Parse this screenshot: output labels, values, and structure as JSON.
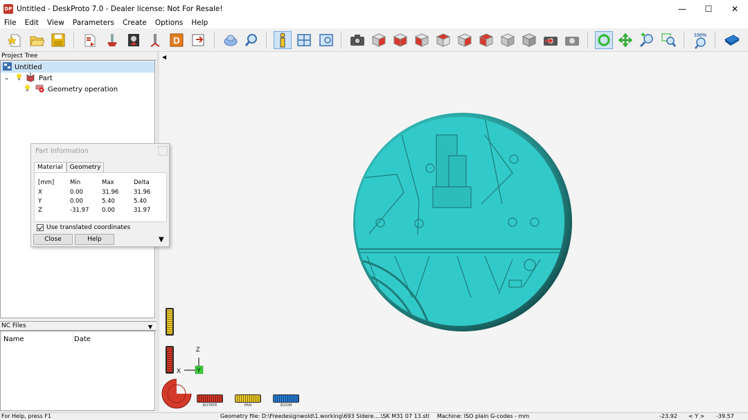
{
  "window": {
    "app_icon": "DP",
    "title": "Untitled - DeskProto 7.0 - Dealer license: Not For Resale!",
    "minimize": "—",
    "maximize": "☐",
    "close": "✕"
  },
  "menu": [
    "File",
    "Edit",
    "View",
    "Parameters",
    "Create",
    "Options",
    "Help"
  ],
  "toolbar": {
    "icons": [
      "new-file-icon",
      "open-folder-icon",
      "save-disk-icon",
      "import-part-icon",
      "add-tool-icon",
      "part-image-icon",
      "cutter-icon",
      "delete-d-icon",
      "export-icon",
      "render-shading-icon",
      "search-zoom-icon",
      "info-icon",
      "single-view-icon",
      "view-settings-icon",
      "camera-icon",
      "view-iso-red-icon",
      "view-front-red-icon",
      "view-right-red-icon",
      "view-back-red-icon",
      "view-left-red-icon",
      "view-top-red-icon",
      "view-bottom-gray-icon",
      "view-wire-gray-icon",
      "camera-red-icon",
      "camera-gray-icon",
      "rotate-icon",
      "pan-icon",
      "zoom-in-icon",
      "zoom-window-icon",
      "zoom-100-icon",
      "book-icon"
    ],
    "zoom_label": "100%"
  },
  "project_tree": {
    "header": "Project Tree",
    "items": [
      {
        "label": "Untitled",
        "icon": "project-icon"
      },
      {
        "label": "Part",
        "icon": "part-icon"
      },
      {
        "label": "Geometry operation",
        "icon": "geometry-error-icon"
      }
    ]
  },
  "nc_files": {
    "header": "NC Files",
    "columns": [
      "Name",
      "Date"
    ]
  },
  "part_info": {
    "title": "Part Information",
    "tabs": [
      "Material",
      "Geometry"
    ],
    "active_tab": "Material",
    "headers": [
      "[mm]",
      "Min",
      "Max",
      "Delta"
    ],
    "rows": [
      [
        "X",
        "0.00",
        "31.96",
        "31.96"
      ],
      [
        "Y",
        "0.00",
        "5.40",
        "5.40"
      ],
      [
        "Z",
        "-31.97",
        "0.00",
        "31.97"
      ]
    ],
    "checkbox_label": "Use translated coordinates",
    "close_label": "Close",
    "help_label": "Help"
  },
  "viewport": {
    "axis_z": "Z",
    "axis_x": "X",
    "axis_y": "Y",
    "model_color": "#2fc7c6",
    "rim_color": "#1a5c5c",
    "controls": [
      {
        "label": "ROTATE",
        "color": "#d43a2a"
      },
      {
        "label": "PAN",
        "color": "#e8c92a"
      },
      {
        "label": "ZOOM",
        "color": "#2a7fd4"
      }
    ]
  },
  "status": {
    "help": "For Help, press F1",
    "geometry_file": "Geometry file: D:\\Freedesignwold\\1.working\\693 Sidere....\\SK M31 07 13.stl",
    "machine": "Machine: ISO plain G-codes - mm",
    "x_value": "-23.92",
    "axis_pair": "< Y >",
    "y_value": "-39.57"
  }
}
